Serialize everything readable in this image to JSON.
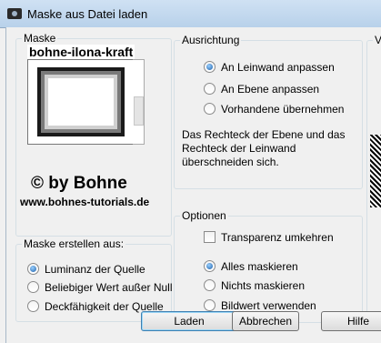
{
  "window": {
    "title": "Maske aus Datei laden"
  },
  "maske": {
    "legend": "Maske",
    "name": "bohne-ilona-kraft",
    "copyright": "© by Bohne",
    "site": "www.bohnes-tutorials.de"
  },
  "erstellen": {
    "legend": "Maske erstellen aus:",
    "options": [
      "Luminanz der Quelle",
      "Beliebiger Wert außer Null",
      "Deckfähigkeit der Quelle"
    ],
    "selected": 0
  },
  "ausrichtung": {
    "legend": "Ausrichtung",
    "options": [
      "An Leinwand anpassen",
      "An Ebene anpassen",
      "Vorhandene übernehmen"
    ],
    "selected": 0,
    "description": "Das Rechteck der Ebene und das Rechteck der Leinwand überschneiden sich."
  },
  "optionen": {
    "legend": "Optionen",
    "invert_label": "Transparenz umkehren",
    "invert_checked": false,
    "options": [
      "Alles maskieren",
      "Nichts maskieren",
      "Bildwert verwenden"
    ],
    "selected": 0
  },
  "vorschau": {
    "legend": "Vor"
  },
  "buttons": {
    "load": "Laden",
    "cancel": "Abbrechen",
    "help": "Hilfe"
  }
}
